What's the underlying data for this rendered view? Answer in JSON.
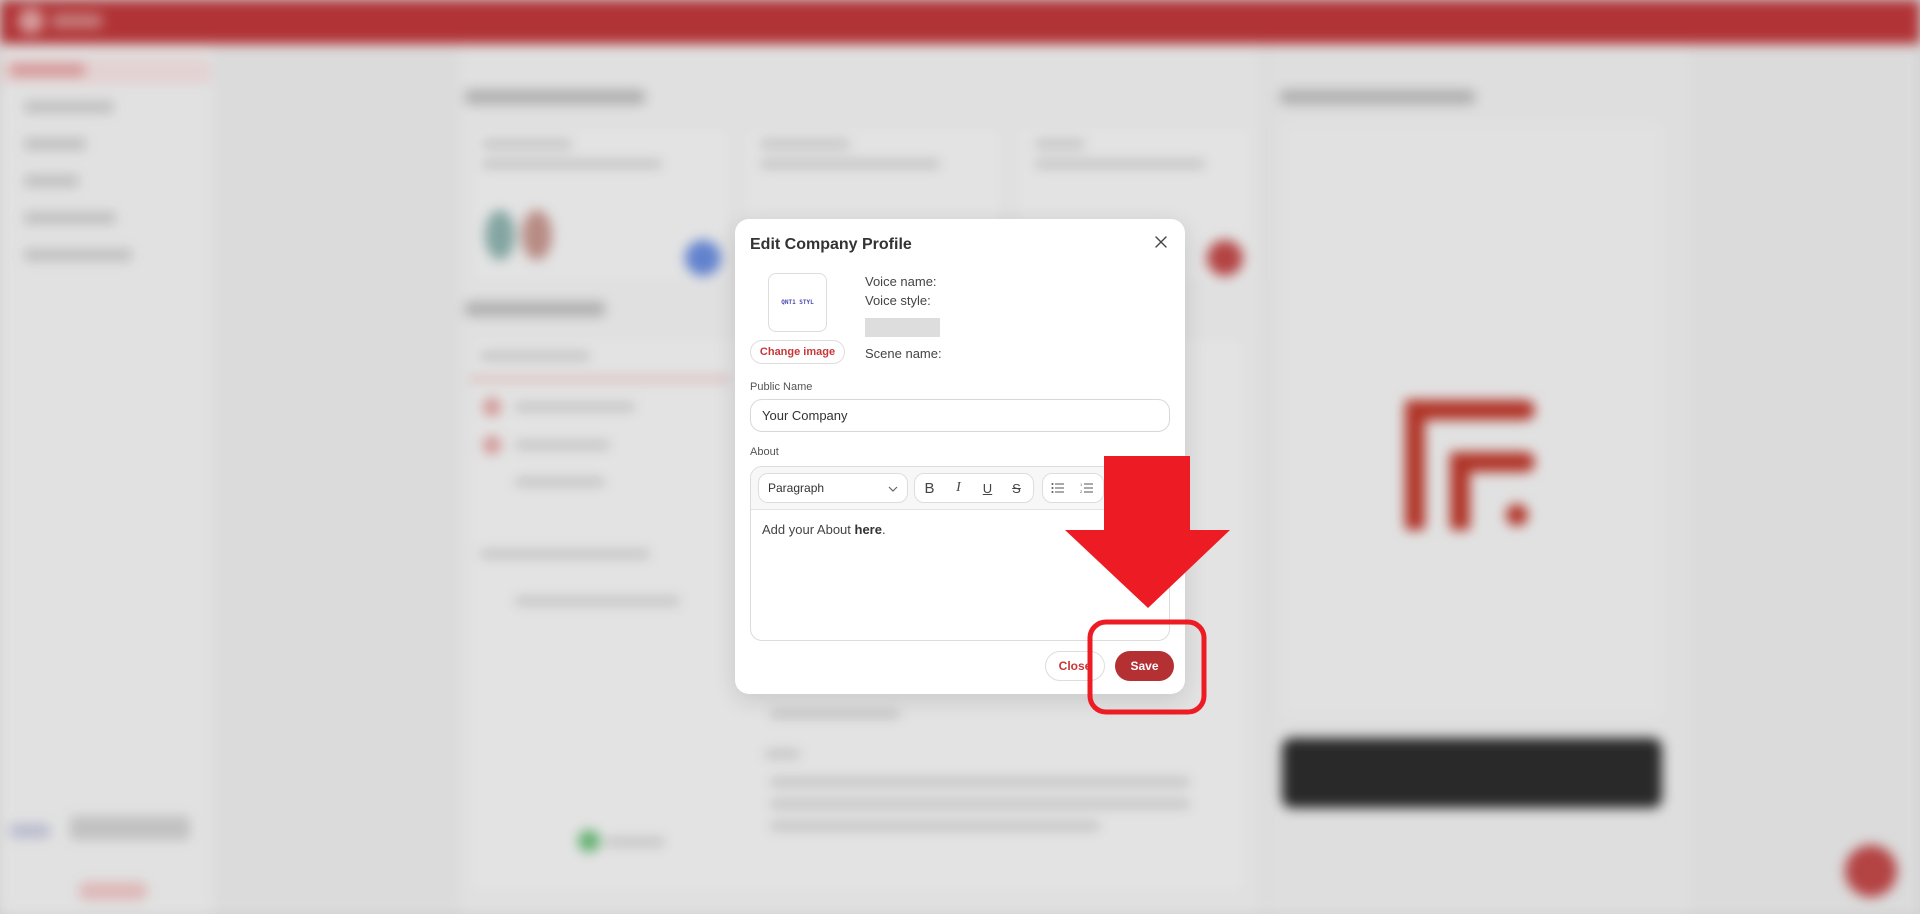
{
  "background": {
    "header_color": "#A82B2E",
    "accent_color": "#B53033"
  },
  "modal": {
    "title": "Edit Company Profile",
    "close_icon": "close-icon",
    "avatar_image_text": "QNT1 STYL",
    "change_image_label": "Change image",
    "voice_name_label": "Voice name:",
    "voice_style_label": "Voice style:",
    "scene_name_label": "Scene name:",
    "public_name": {
      "label": "Public Name",
      "value": "Your Company"
    },
    "about": {
      "label": "About",
      "block_format": "Paragraph",
      "toolbar": {
        "bold": "B",
        "italic": "I",
        "underline": "U",
        "strikethrough": "S",
        "bullet_list_icon": "bullet-list-icon",
        "numbered_list_icon": "numbered-list-icon"
      },
      "content_prefix": "Add your About ",
      "content_bold": "here",
      "content_suffix": "."
    },
    "close_button_label": "Close",
    "save_button_label": "Save"
  },
  "annotation": {
    "color": "#ED1C24",
    "type": "arrow-pointing-to-save-button"
  }
}
